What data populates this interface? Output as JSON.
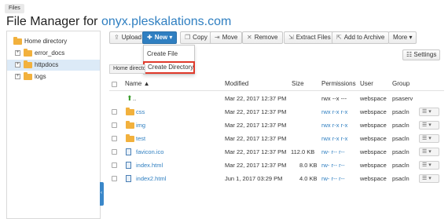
{
  "breadcrumb": "Files",
  "page_title": {
    "prefix": "File Manager for ",
    "host": "onyx.pleskalations.com"
  },
  "sidebar": {
    "items": [
      {
        "label": "Home directory"
      },
      {
        "label": "error_docs"
      },
      {
        "label": "httpdocs"
      },
      {
        "label": "logs"
      }
    ]
  },
  "toolbar": {
    "upload": "Upload",
    "new": "New",
    "copy": "Copy",
    "move": "Move",
    "remove": "Remove",
    "extract": "Extract Files",
    "archive": "Add to Archive",
    "more": "More"
  },
  "new_menu": {
    "items": [
      "Create File",
      "Create Directory"
    ]
  },
  "settings": "Settings",
  "path_bar": "Home directory",
  "table": {
    "headers": {
      "name": "Name",
      "modified": "Modified",
      "size": "Size",
      "permissions": "Permissions",
      "user": "User",
      "group": "Group"
    },
    "sort_indicator": "▲",
    "rows": [
      {
        "name": "..",
        "modified": "Mar 22, 2017 12:37 PM",
        "size": "",
        "permissions": "rwx --x ---",
        "user": "webspace",
        "group": "psaserv"
      },
      {
        "name": "css",
        "modified": "Mar 22, 2017 12:37 PM",
        "size": "",
        "permissions": "rwx r-x r-x",
        "user": "webspace",
        "group": "psacln"
      },
      {
        "name": "img",
        "modified": "Mar 22, 2017 12:37 PM",
        "size": "",
        "permissions": "rwx r-x r-x",
        "user": "webspace",
        "group": "psacln"
      },
      {
        "name": "test",
        "modified": "Mar 22, 2017 12:37 PM",
        "size": "",
        "permissions": "rwx r-x r-x",
        "user": "webspace",
        "group": "psacln"
      },
      {
        "name": "favicon.ico",
        "modified": "Mar 22, 2017 12:37 PM",
        "size": "112.0 KB",
        "permissions": "rw- r-- r--",
        "user": "webspace",
        "group": "psacln"
      },
      {
        "name": "index.html",
        "modified": "Mar 22, 2017 12:37 PM",
        "size": "8.0 KB",
        "permissions": "rw- r-- r--",
        "user": "webspace",
        "group": "psacln"
      },
      {
        "name": "index2.html",
        "modified": "Jun 1, 2017 03:29 PM",
        "size": "4.0 KB",
        "permissions": "rw- r-- r--",
        "user": "webspace",
        "group": "psacln"
      }
    ]
  },
  "colors": {
    "accent": "#2f7fc1",
    "folder": "#f2b13d",
    "highlight": "#e03a2b",
    "selected_row": "#dceaf7"
  }
}
